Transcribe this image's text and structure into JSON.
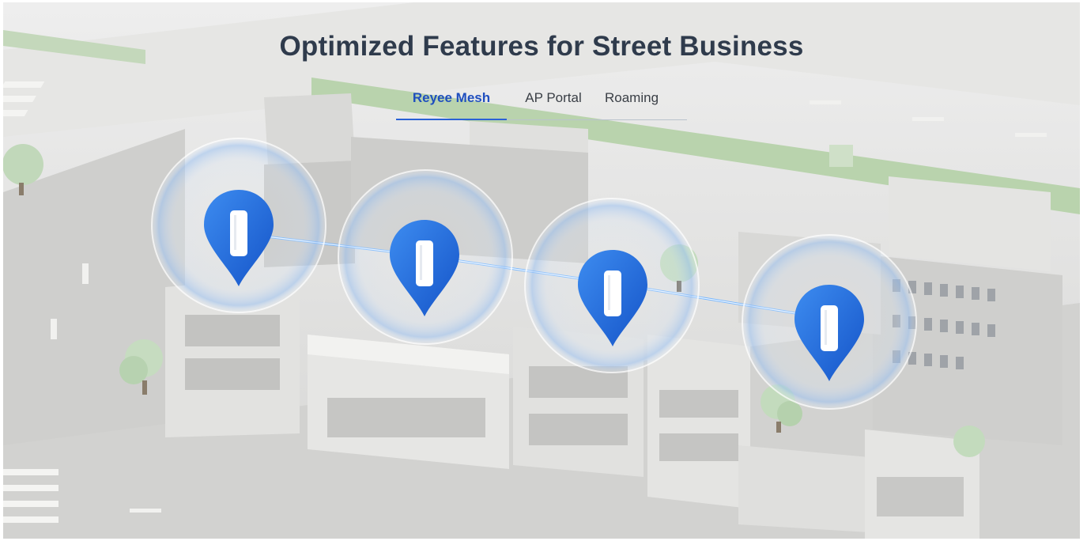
{
  "header": {
    "title": "Optimized Features for Street Business"
  },
  "tabs": [
    {
      "label": "Reyee Mesh",
      "active": true
    },
    {
      "label": "AP Portal",
      "active": false
    },
    {
      "label": "Roaming",
      "active": false
    }
  ],
  "colors": {
    "accent": "#2a62d6",
    "title": "#2f3b4c",
    "pin": "#1f6ad8",
    "ground": "#dcdcda"
  },
  "illustration": {
    "access_point_count": 4,
    "icon": "access-point-pin-icon"
  }
}
